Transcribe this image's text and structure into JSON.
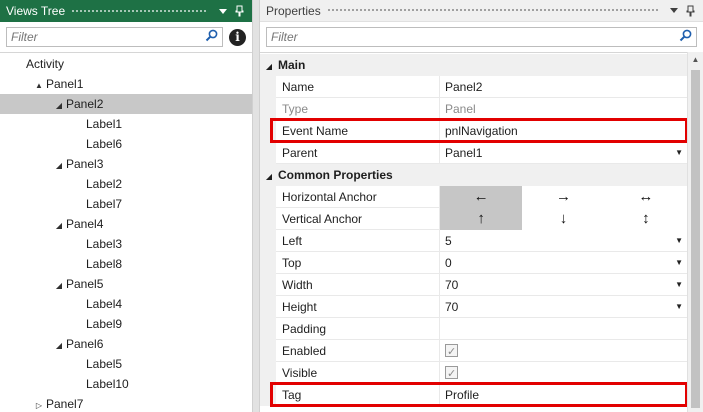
{
  "views_tree": {
    "title": "Views Tree",
    "filter_placeholder": "Filter",
    "items": [
      {
        "label": "Activity",
        "level": 0,
        "expander": ""
      },
      {
        "label": "Panel1",
        "level": 1,
        "expander": "▲"
      },
      {
        "label": "Panel2",
        "level": 2,
        "expander": "◢",
        "selected": true
      },
      {
        "label": "Label1",
        "level": 3,
        "expander": ""
      },
      {
        "label": "Label6",
        "level": 3,
        "expander": ""
      },
      {
        "label": "Panel3",
        "level": 2,
        "expander": "◢"
      },
      {
        "label": "Label2",
        "level": 3,
        "expander": ""
      },
      {
        "label": "Label7",
        "level": 3,
        "expander": ""
      },
      {
        "label": "Panel4",
        "level": 2,
        "expander": "◢"
      },
      {
        "label": "Label3",
        "level": 3,
        "expander": ""
      },
      {
        "label": "Label8",
        "level": 3,
        "expander": ""
      },
      {
        "label": "Panel5",
        "level": 2,
        "expander": "◢"
      },
      {
        "label": "Label4",
        "level": 3,
        "expander": ""
      },
      {
        "label": "Label9",
        "level": 3,
        "expander": ""
      },
      {
        "label": "Panel6",
        "level": 2,
        "expander": "◢"
      },
      {
        "label": "Label5",
        "level": 3,
        "expander": ""
      },
      {
        "label": "Label10",
        "level": 3,
        "expander": ""
      },
      {
        "label": "Panel7",
        "level": 1,
        "expander": "▷"
      }
    ]
  },
  "properties": {
    "title": "Properties",
    "filter_placeholder": "Filter",
    "sections": [
      {
        "title": "Main",
        "rows": [
          {
            "name": "Name",
            "value": "Panel2"
          },
          {
            "name": "Type",
            "value": "Panel",
            "disabled": true
          },
          {
            "name": "Event Name",
            "value": "pnlNavigation",
            "highlighted": true
          },
          {
            "name": "Parent",
            "value": "Panel1",
            "dropdown": true
          }
        ]
      },
      {
        "title": "Common Properties",
        "rows": [
          {
            "name": "Horizontal Anchor",
            "anchors": [
              "←",
              "→",
              "↔"
            ],
            "selected_anchor": 0
          },
          {
            "name": "Vertical Anchor",
            "anchors": [
              "↑",
              "↓",
              "↕"
            ],
            "selected_anchor": 0
          },
          {
            "name": "Left",
            "value": "5",
            "dropdown": true
          },
          {
            "name": "Top",
            "value": "0",
            "dropdown": true
          },
          {
            "name": "Width",
            "value": "70",
            "dropdown": true
          },
          {
            "name": "Height",
            "value": "70",
            "dropdown": true
          },
          {
            "name": "Padding",
            "value": ""
          },
          {
            "name": "Enabled",
            "checkbox": true,
            "checked": true
          },
          {
            "name": "Visible",
            "checkbox": true,
            "checked": true
          },
          {
            "name": "Tag",
            "value": "Profile",
            "highlighted": true
          }
        ]
      }
    ]
  },
  "icons": {
    "dropdown": "chevron-down-icon",
    "pin": "pin-icon",
    "search": "search-icon",
    "info": "info-icon",
    "check": "checkmark-icon"
  },
  "colors": {
    "active_title_bg": "#1e7145",
    "selection_bg": "#c8c8c8",
    "highlight_border": "#e20000"
  }
}
